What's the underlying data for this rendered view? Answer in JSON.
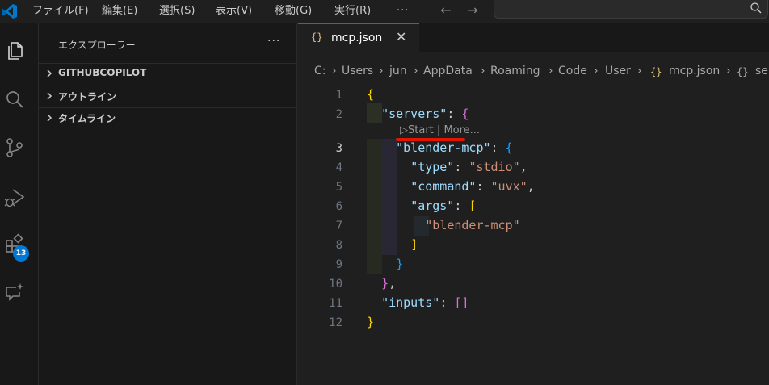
{
  "menu": {
    "file": "ファイル(F)",
    "edit": "編集(E)",
    "selection": "選択(S)",
    "view": "表示(V)",
    "go": "移動(G)",
    "run": "実行(R)",
    "more": "···"
  },
  "activity": {
    "extensions_badge": "13"
  },
  "sidebar": {
    "title": "エクスプローラー",
    "more": "···",
    "sections": [
      {
        "label": "GITHUBCOPILOT"
      },
      {
        "label": "アウトライン"
      },
      {
        "label": "タイムライン"
      }
    ]
  },
  "tab": {
    "icon": "{}",
    "label": "mcp.json",
    "close": "✕"
  },
  "breadcrumb": [
    "C:",
    "Users",
    "jun",
    "AppData",
    "Roaming",
    "Code",
    "User",
    "mcp.json",
    "se"
  ],
  "breadcrumb_icons": [
    "{}",
    "{}"
  ],
  "codelens": {
    "start": "Start",
    "sep": "|",
    "more": "More..."
  },
  "line_numbers": [
    "1",
    "2",
    "3",
    "4",
    "5",
    "6",
    "7",
    "8",
    "9",
    "10",
    "11",
    "12"
  ],
  "active_line": "3",
  "code": {
    "l1": {
      "open": "{"
    },
    "l2": {
      "key": "\"servers\"",
      "colon": ": ",
      "open": "{"
    },
    "l3": {
      "key": "\"blender-mcp\"",
      "colon": ": ",
      "open": "{"
    },
    "l4": {
      "key": "\"type\"",
      "colon": ": ",
      "value": "\"stdio\"",
      "comma": ","
    },
    "l5": {
      "key": "\"command\"",
      "colon": ": ",
      "value": "\"uvx\"",
      "comma": ","
    },
    "l6": {
      "key": "\"args\"",
      "colon": ": ",
      "open": "["
    },
    "l7": {
      "value": "\"blender-mcp\""
    },
    "l8": {
      "close": "]"
    },
    "l9": {
      "close": "}"
    },
    "l10": {
      "close": "}",
      "comma": ","
    },
    "l11": {
      "key": "\"inputs\"",
      "colon": ": ",
      "value": "[]"
    },
    "l12": {
      "close": "}"
    }
  },
  "colors": {
    "accent": "#0078d4",
    "editor_bg": "#1f1f1f",
    "sidebar_bg": "#181818",
    "annotation_underline": "#e51400"
  }
}
